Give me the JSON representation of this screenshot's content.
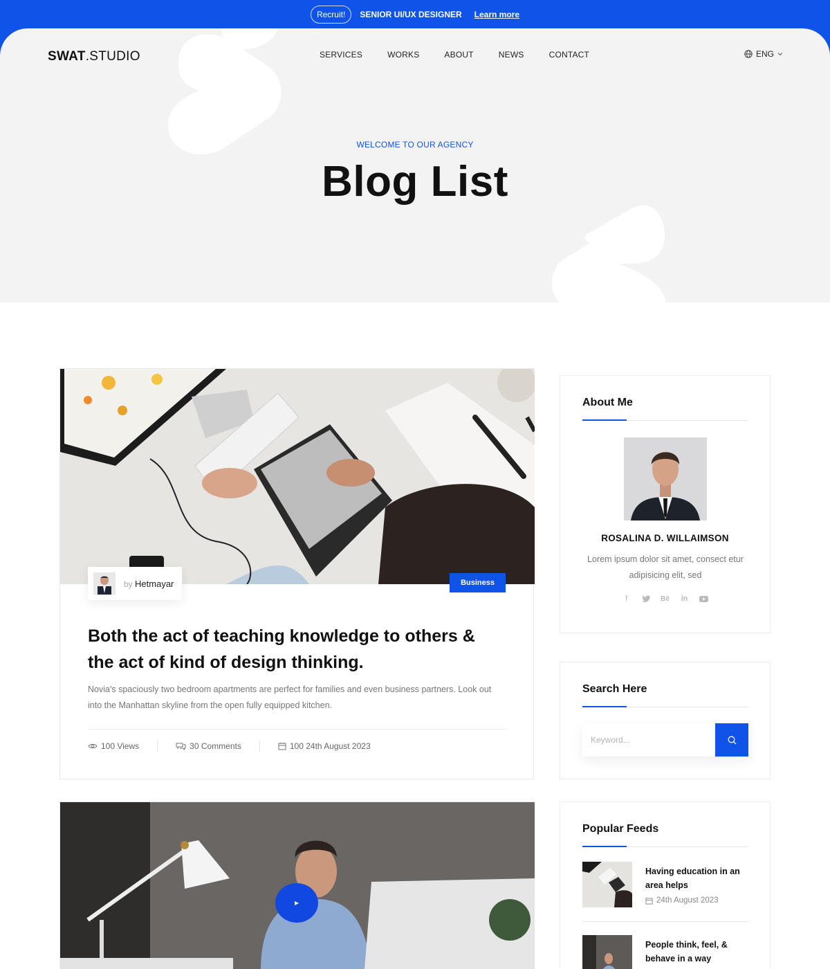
{
  "topbar": {
    "badge": "Recruit!",
    "title": "SENIOR UI/UX DESIGNER",
    "link": "Learn more"
  },
  "header": {
    "brand_bold": "SWAT",
    "brand_rest": ".STUDIO",
    "nav": [
      "SERVICES",
      "WORKS",
      "ABOUT",
      "NEWS",
      "CONTACT"
    ],
    "lang": "ENG"
  },
  "hero": {
    "eyebrow": "WELCOME TO OUR AGENCY",
    "title": "Blog List"
  },
  "posts": [
    {
      "author_prefix": "by",
      "author": "Hetmayar",
      "category": "Business",
      "title": "Both the act of teaching knowledge to others & the act of kind of design thinking.",
      "excerpt": "Novia's spaciously two bedroom apartments are perfect for families and even business partners. Look out into the Manhattan skyline from the open fully equipped kitchen.",
      "views": "100 Views",
      "comments": "30 Comments",
      "date": "100 24th August 2023"
    }
  ],
  "sidebar": {
    "about": {
      "title": "About Me",
      "name": "ROSALINA D. WILLAIMSON",
      "bio": "Lorem ipsum dolor sit amet, consect etur adipisicing elit, sed",
      "socials": [
        "facebook-icon",
        "twitter-icon",
        "behance-icon",
        "linkedin-icon",
        "youtube-icon"
      ]
    },
    "search": {
      "title": "Search Here",
      "placeholder": "Keyword..."
    },
    "popular": {
      "title": "Popular Feeds",
      "items": [
        {
          "title": "Having education in an area helps",
          "date": "24th August 2023"
        },
        {
          "title": "People think, feel, & behave in a way",
          "date": ""
        }
      ]
    }
  },
  "colors": {
    "accent": "#1053e8",
    "hero_bg": "#f3f3f3"
  }
}
